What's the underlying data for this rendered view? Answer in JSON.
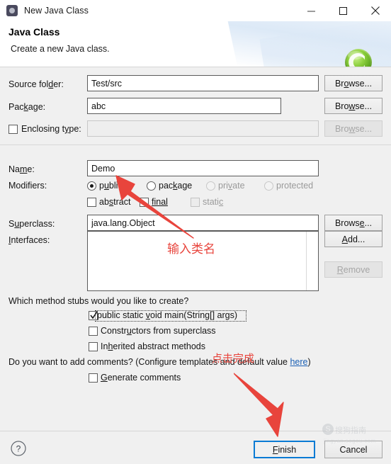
{
  "window": {
    "title": "New Java Class",
    "icon": "java-class-wizard-icon",
    "minimize_label": "—",
    "maximize_label": "□",
    "close_label": "✕"
  },
  "header": {
    "title": "Java Class",
    "subtitle": "Create a new Java class.",
    "logo": "green-class-icon"
  },
  "form": {
    "source_folder": {
      "label": "Source folder:",
      "label_pre": "Source fol",
      "label_accel": "d",
      "label_post": "er:",
      "value": "Test/src",
      "browse": {
        "pre": "Br",
        "accel": "o",
        "post": "wse...",
        "enabled": true
      }
    },
    "package": {
      "label": "Package:",
      "label_pre": "Pac",
      "label_accel": "k",
      "label_post": "age:",
      "value": "abc",
      "browse": {
        "pre": "Bro",
        "accel": "w",
        "post": "se...",
        "enabled": true
      }
    },
    "enclosing_type": {
      "label": "Enclosing type:",
      "label_pre": "Enclosing t",
      "label_accel": "y",
      "label_post": "pe:",
      "checked": false,
      "value": "",
      "enabled": false,
      "browse": {
        "pre": "Bro",
        "accel": "w",
        "post": "se...",
        "enabled": false
      }
    },
    "name": {
      "label": "Name:",
      "label_pre": "Na",
      "label_accel": "m",
      "label_post": "e:",
      "value": "Demo"
    },
    "modifiers": {
      "label": "Modifiers:",
      "radios": [
        {
          "pre": "p",
          "accel": "u",
          "post": "blic",
          "label": "public",
          "selected": true,
          "enabled": true
        },
        {
          "pre": "pac",
          "accel": "k",
          "post": "age",
          "label": "package",
          "selected": false,
          "enabled": true
        },
        {
          "pre": "pri",
          "accel": "v",
          "post": "ate",
          "label": "private",
          "selected": false,
          "enabled": false
        },
        {
          "pre": "protected",
          "accel": "",
          "post": "",
          "label": "protected",
          "selected": false,
          "enabled": false
        }
      ],
      "checkboxes": [
        {
          "pre": "ab",
          "accel": "s",
          "post": "tract",
          "label": "abstract",
          "checked": false,
          "enabled": true
        },
        {
          "pre": "final",
          "accel": "",
          "post": "",
          "label": "final",
          "checked": false,
          "enabled": true
        },
        {
          "pre": "stati",
          "accel": "c",
          "post": "",
          "label": "static",
          "checked": false,
          "enabled": false
        }
      ]
    },
    "superclass": {
      "label": "Superclass:",
      "label_pre": "S",
      "label_accel": "u",
      "label_post": "perclass:",
      "value": "java.lang.Object",
      "browse": {
        "pre": "Brows",
        "accel": "e",
        "post": "...",
        "enabled": true
      }
    },
    "interfaces": {
      "label": "Interfaces:",
      "label_pre": "",
      "label_accel": "I",
      "label_post": "nterfaces:",
      "items": [],
      "add": {
        "pre": "",
        "accel": "A",
        "post": "dd...",
        "enabled": true
      },
      "remove": {
        "pre": "",
        "accel": "R",
        "post": "emove",
        "enabled": false
      }
    }
  },
  "stubs": {
    "question": "Which method stubs would you like to create?",
    "options": [
      {
        "label": "public static void main(String[] args)",
        "pre": "public static ",
        "accel": "v",
        "post": "oid main(String[] args)",
        "checked": true,
        "focused": true
      },
      {
        "label": "Constructors from superclass",
        "pre": "Constr",
        "accel": "u",
        "post": "ctors from superclass",
        "checked": false,
        "focused": false
      },
      {
        "label": "Inherited abstract methods",
        "pre": "In",
        "accel": "h",
        "post": "erited abstract methods",
        "checked": false,
        "focused": false
      }
    ]
  },
  "comments": {
    "question_pre": "Do you want to add comments? (Configure templates and default value ",
    "link": "here",
    "question_post": ")",
    "generate": {
      "pre": "",
      "accel": "G",
      "post": "enerate comments",
      "label": "Generate comments",
      "checked": false
    }
  },
  "footer": {
    "help": "?",
    "finish": {
      "pre": "",
      "accel": "F",
      "post": "inish"
    },
    "cancel": "Cancel"
  },
  "annotations": [
    {
      "id": "enter-class-name",
      "text": "输入类名",
      "color": "#e8443c"
    },
    {
      "id": "click-finish",
      "text": "点击完成",
      "color": "#e8443c"
    }
  ],
  "watermark": {
    "mark": "S",
    "text": "搜狗指南",
    "sub": "jingyan.sogou.com"
  },
  "colors": {
    "accent_blue": "#0a7bd4",
    "annotation_red": "#e8443c",
    "link_blue": "#1a5fb4",
    "dialog_bg": "#f0f0f0"
  }
}
